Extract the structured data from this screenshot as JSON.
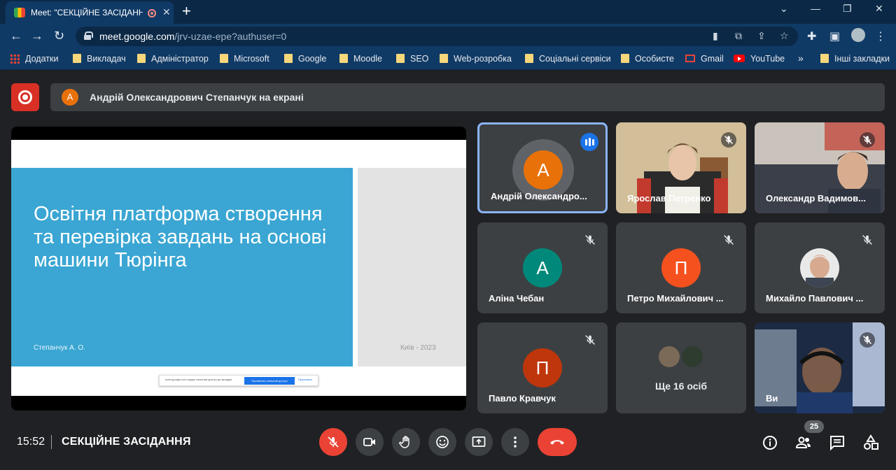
{
  "browser": {
    "tab_title": "Meet: \"СЕКЦІЙНЕ ЗАСІДАНН",
    "tab_close": "✕",
    "new_tab": "+",
    "window_controls": {
      "dropdown": "⌄",
      "minimize": "—",
      "restore": "❐",
      "close": "✕"
    },
    "url_host": "meet.google.com",
    "url_path": "/jrv-uzae-epe?authuser=0",
    "bookmarks": [
      {
        "label": "Додатки",
        "icon": "apps-grid-icon"
      },
      {
        "label": "Викладач",
        "icon": "folder-icon"
      },
      {
        "label": "Адміністратор",
        "icon": "folder-icon"
      },
      {
        "label": "Microsoft",
        "icon": "folder-icon"
      },
      {
        "label": "Google",
        "icon": "folder-icon"
      },
      {
        "label": "Moodle",
        "icon": "folder-icon"
      },
      {
        "label": "SEO",
        "icon": "folder-icon"
      },
      {
        "label": "Web-розробка",
        "icon": "folder-icon"
      },
      {
        "label": "Соціальні сервіси",
        "icon": "folder-icon"
      },
      {
        "label": "Особисте",
        "icon": "folder-icon"
      },
      {
        "label": "Gmail",
        "icon": "gmail-icon"
      },
      {
        "label": "YouTube",
        "icon": "youtube-icon"
      },
      {
        "label": "»",
        "icon": "overflow-icon"
      },
      {
        "label": "Інші закладки",
        "icon": "folder-icon"
      }
    ]
  },
  "meet": {
    "banner_avatar": "А",
    "banner_text": "Андрій Олександрович Степанчук на екрані",
    "slide": {
      "headline": "Освітня платформа створення та перевірка завдань на основі машини Тюрінга",
      "author": "Степанчук А. О.",
      "city": "Київ - 2023",
      "share_notice": "meet.google.com надає спільний доступ до вкладки",
      "share_stop": "Припинити спільний доступ",
      "share_hide": "Приховати"
    },
    "participants": [
      {
        "name": "Андрій Олександро...",
        "avatar": "А",
        "avatar_color": "#e8710a",
        "speaking": true
      },
      {
        "name": "Ярослав Петренко",
        "muted": true,
        "video": true
      },
      {
        "name": "Олександр Вадимов...",
        "muted": true,
        "video": true
      },
      {
        "name": "Аліна Чебан",
        "avatar": "А",
        "avatar_color": "#00897b",
        "muted": true
      },
      {
        "name": "Петро Михайлович ...",
        "avatar": "П",
        "avatar_color": "#f4511e",
        "muted": true
      },
      {
        "name": "Михайло Павлович ...",
        "muted": true,
        "photo": true
      },
      {
        "name": "Павло Кравчук",
        "avatar": "П",
        "avatar_color": "#bf360c",
        "muted": true
      },
      {
        "name": "Ще 16 осіб"
      },
      {
        "name": "Ви",
        "muted": true,
        "video": true
      }
    ],
    "time": "15:52",
    "meeting_title": "СЕКЦІЙНЕ ЗАСІДАННЯ",
    "people_count": "25",
    "colors": {
      "accent": "#8ab4f8",
      "danger": "#ea4335",
      "surface": "#3c4043",
      "background": "#202124"
    }
  }
}
